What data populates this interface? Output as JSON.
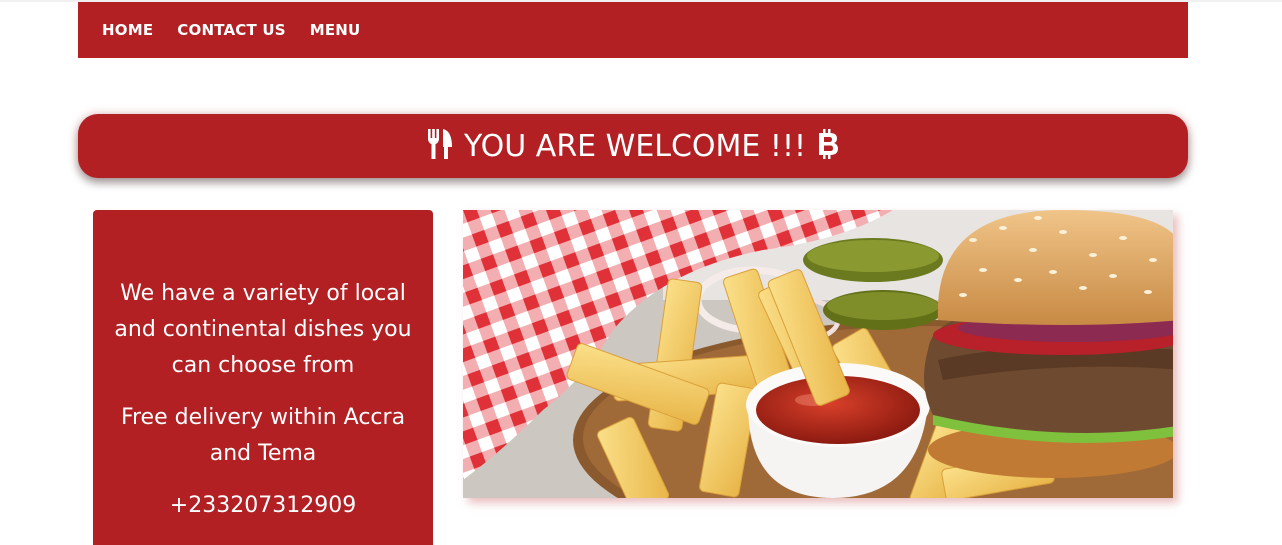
{
  "nav": {
    "items": [
      {
        "label": "HOME"
      },
      {
        "label": "CONTACT US"
      },
      {
        "label": "MENU"
      }
    ]
  },
  "banner": {
    "title": "YOU ARE WELCOME !!!",
    "left_icon": "utensils-icon",
    "right_icon": "bitcoin-icon"
  },
  "info": {
    "line1": "We have a variety of local and continental dishes you can choose from",
    "line2": "Free delivery within Accra and Tema",
    "phone": "+233207312909"
  },
  "hero_image": {
    "subject": "burger-fries-ketchup-photo"
  },
  "colors": {
    "brand_red": "#b22024",
    "text_light": "#ffffff"
  }
}
